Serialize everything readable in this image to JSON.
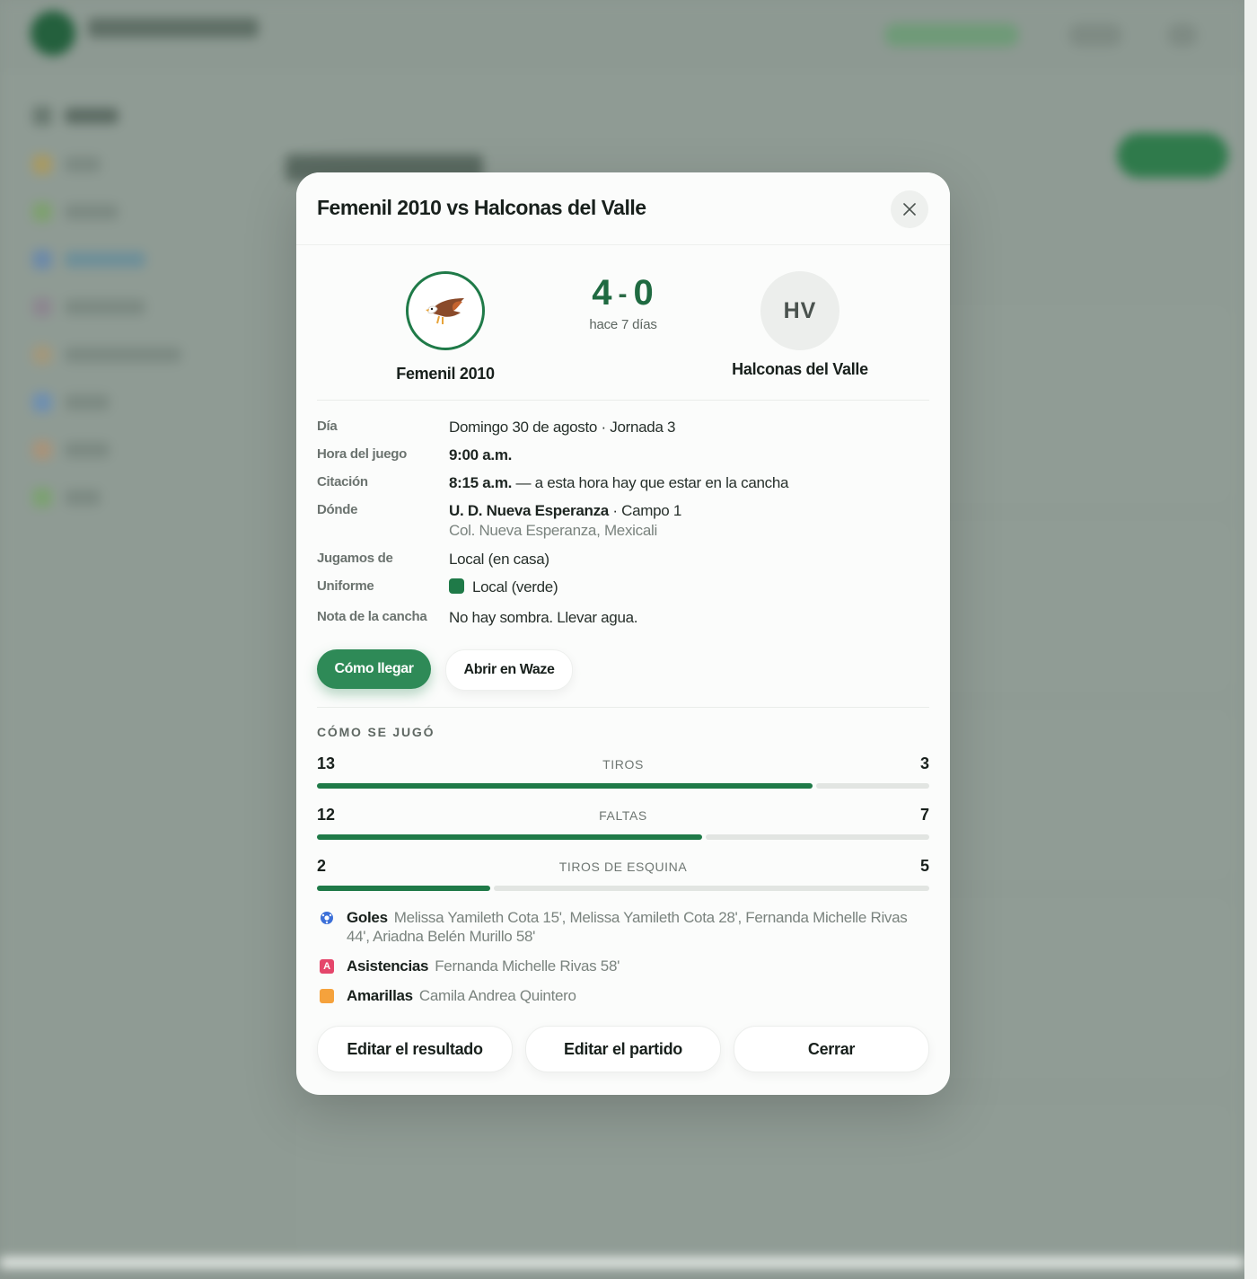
{
  "modal": {
    "title": "Femenil 2010 vs Halconas del Valle",
    "home": {
      "name": "Femenil 2010",
      "crest_icon": "eagle-icon"
    },
    "away": {
      "name": "Halconas del Valle",
      "initials": "HV"
    },
    "score": {
      "home": "4",
      "separator": "-",
      "away": "0",
      "when": "hace 7 días"
    },
    "details": {
      "dia_label": "Día",
      "dia_value": "Domingo 30 de agosto · Jornada 3",
      "hora_label": "Hora del juego",
      "hora_value": "9:00 a.m.",
      "citacion_label": "Citación",
      "citacion_time": "8:15 a.m.",
      "citacion_note": " — a esta hora hay que estar en la cancha",
      "donde_label": "Dónde",
      "donde_place": "U. D. Nueva Esperanza",
      "donde_field": " · Campo 1",
      "donde_address": "Col. Nueva Esperanza, Mexicali",
      "jugamos_label": "Jugamos de",
      "jugamos_value": "Local (en casa)",
      "uniforme_label": "Uniforme",
      "uniforme_value": "Local (verde)",
      "uniforme_color": "#1f7a48",
      "nota_label": "Nota de la cancha",
      "nota_value": "No hay sombra. Llevar agua."
    },
    "actions": {
      "directions": "Cómo llegar",
      "waze": "Abrir en Waze"
    },
    "stats_title": "CÓMO SE JUGÓ",
    "stats": [
      {
        "label": "TIROS",
        "home": 13,
        "away": 3
      },
      {
        "label": "FALTAS",
        "home": 12,
        "away": 7
      },
      {
        "label": "TIROS DE ESQUINA",
        "home": 2,
        "away": 5
      }
    ],
    "events": {
      "goals_label": "Goles",
      "goals_value": "Melissa Yamileth Cota 15', Melissa Yamileth Cota 28', Fernanda Michelle Rivas 44', Ariadna Belén Murillo 58'",
      "assists_label": "Asistencias",
      "assists_value": "Fernanda Michelle Rivas 58'",
      "yellow_label": "Amarillas",
      "yellow_value": "Camila Andrea Quintero"
    },
    "footer": {
      "edit_result": "Editar el resultado",
      "edit_match": "Editar el partido",
      "close": "Cerrar"
    }
  },
  "colors": {
    "primary": "#2e8a57",
    "bar_home": "#1f7a48",
    "bar_away": "#e2e5e2"
  }
}
